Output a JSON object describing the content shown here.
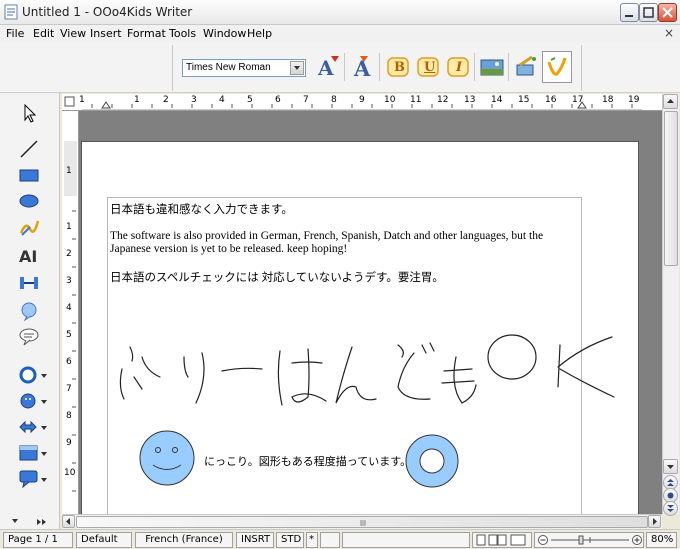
{
  "window": {
    "title": "Untitled 1 - OOo4Kids Writer",
    "close_glyph": "×"
  },
  "menu": [
    "File",
    "Edit",
    "View",
    "Insert",
    "Format",
    "Tools",
    "Window",
    "Help"
  ],
  "toolbar": {
    "font_name": "Times New Roman",
    "buttons": [
      "font-color-icon",
      "font-size-icon",
      "bold-icon",
      "underline-icon",
      "italic-icon",
      "insert-image-icon",
      "gallery-icon",
      "special-icon"
    ],
    "bold_label": "B",
    "underline_label": "U",
    "italic_label": "I"
  },
  "left_tools": [
    "select-icon",
    "line-icon",
    "rectangle-icon",
    "ellipse-icon",
    "freeform-icon",
    "fontwork-icon",
    "connector-icon",
    "callout-icon",
    "text-bubble-icon",
    "basic-shapes-icon",
    "symbol-shapes-icon",
    "arrows-icon",
    "flowchart-icon",
    "callouts-icon"
  ],
  "ruler": {
    "h_numbers": [
      "1",
      "1",
      "2",
      "3",
      "4",
      "5",
      "6",
      "7",
      "8",
      "9",
      "10",
      "11",
      "12",
      "13",
      "14",
      "15",
      "16",
      "17",
      "18",
      "19"
    ],
    "v_numbers": [
      "1",
      "1",
      "2",
      "3",
      "4",
      "5",
      "6",
      "7",
      "8",
      "9",
      "10"
    ]
  },
  "document": {
    "line1": "日本語も違和感なく入力できます。",
    "line2a": "The software is also provided in German, French, Spanish, Datch and other languages, but the",
    "line2b": "Japanese version is yet to be released. keep hoping!",
    "line3": "日本語のスペルチェックには 対応していないようデす。要注胃。",
    "handwriting": "ふりーはんどもOK",
    "caption": "にっこり。図形もある程度描っています。"
  },
  "statusbar": {
    "page": "Page 1 / 1",
    "style": "Default",
    "language": "French (France)",
    "insert_mode": "INSRT",
    "selection_mode": "STD",
    "modified": "*",
    "zoom": "80%"
  }
}
